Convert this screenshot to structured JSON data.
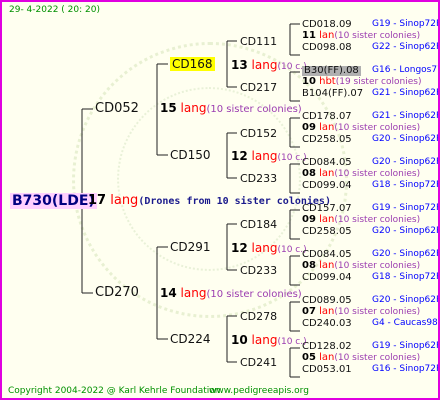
{
  "header": {
    "date": "29-  4-2022 ( 20: 20)"
  },
  "footer": {
    "copyright": "Copyright 2004-2022 @ Karl Kehrle Foundation",
    "url": "www.pedigreeapis.org"
  },
  "root": {
    "id": "B730(LDE)",
    "num": "17",
    "lang": "lang",
    "desc": "(Drones from 10 sister colonies)"
  },
  "gen1": [
    {
      "id": "CD052",
      "num": "15",
      "lang": "lang",
      "desc": "(10 sister colonies)"
    },
    {
      "id": "CD270",
      "num": "14",
      "lang": "lang",
      "desc": "(10 sister colonies)"
    }
  ],
  "gen2": [
    {
      "id": "CD168",
      "num": "13",
      "lang": "lang",
      "desc": "(10 c.)"
    },
    {
      "id": "CD150",
      "num": "12",
      "lang": "lang",
      "desc": "(10 c.)"
    },
    {
      "id": "CD291",
      "num": "12",
      "lang": "lang",
      "desc": "(10 c.)"
    },
    {
      "id": "CD224",
      "num": "10",
      "lang": "lang",
      "desc": "(10 c.)"
    }
  ],
  "gen3": [
    "CD111",
    "CD217",
    "CD152",
    "CD233",
    "CD184",
    "CD233",
    "CD278",
    "CD241"
  ],
  "gen4": [
    {
      "a": "CD018.09",
      "ta": "G19 - Sinop72R",
      "n": "11",
      "l": "lan",
      "d": "(10 sister colonies)",
      "b": "CD098.08",
      "tb": "G22 - Sinop62R"
    },
    {
      "a": "B30(FF).08",
      "ta": "G16 - Longos77R",
      "n": "10",
      "l": "hbt",
      "d": "(19 sister colonies)",
      "b": "B104(FF).07",
      "tb": "G21 - Sinop62R"
    },
    {
      "a": "CD178.07",
      "ta": "G21 - Sinop62R",
      "n": "09",
      "l": "lan",
      "d": "(10 sister colonies)",
      "b": "CD258.05",
      "tb": "G20 - Sinop62R"
    },
    {
      "a": "CD084.05",
      "ta": "G20 - Sinop62R",
      "n": "08",
      "l": "lan",
      "d": "(10 sister colonies)",
      "b": "CD099.04",
      "tb": "G18 - Sinop72R"
    },
    {
      "a": "CD157.07",
      "ta": "G19 - Sinop72R",
      "n": "09",
      "l": "lan",
      "d": "(10 sister colonies)",
      "b": "CD258.05",
      "tb": "G20 - Sinop62R"
    },
    {
      "a": "CD084.05",
      "ta": "G20 - Sinop62R",
      "n": "08",
      "l": "lan",
      "d": "(10 sister colonies)",
      "b": "CD099.04",
      "tb": "G18 - Sinop72R"
    },
    {
      "a": "CD089.05",
      "ta": "G20 - Sinop62R",
      "n": "07",
      "l": "lan",
      "d": "(10 sister colonies)",
      "b": "CD240.03",
      "tb": "G4 - Caucas98R"
    },
    {
      "a": "CD128.02",
      "ta": "G19 - Sinop62R",
      "n": "05",
      "l": "lan",
      "d": "(10 sister colonies)",
      "b": "CD053.01",
      "tb": "G16 - Sinop72R"
    }
  ]
}
